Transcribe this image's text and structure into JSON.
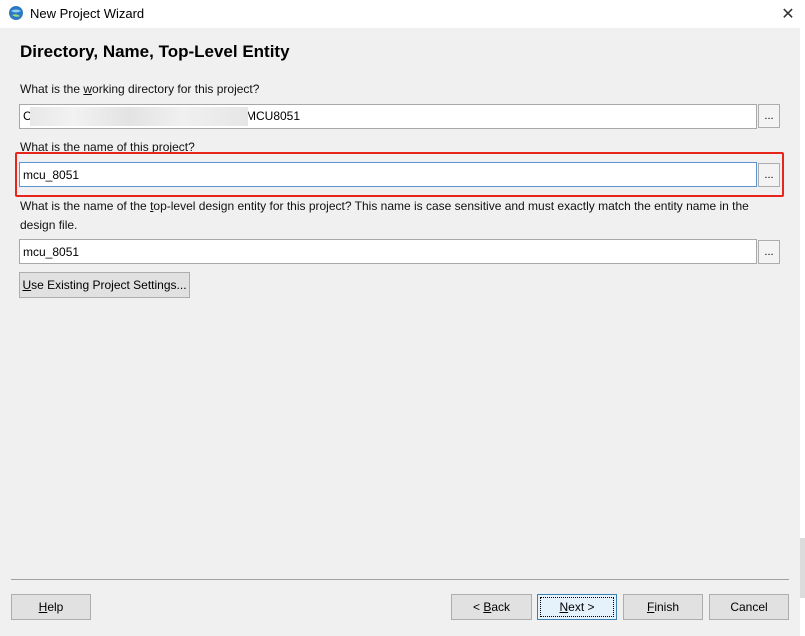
{
  "window": {
    "title": "New Project Wizard",
    "close_glyph": "✕",
    "icon": "app-globe-icon"
  },
  "page": {
    "title": "Directory, Name, Top-Level Entity"
  },
  "working_directory": {
    "label_prefix": "What is the ",
    "label_underlined": "w",
    "label_suffix": "orking directory for this project?",
    "value_start": "C",
    "value_end": "MCU8051",
    "browse_label": "..."
  },
  "project_name": {
    "label": "What is the name of this project?",
    "value": "mcu_8051",
    "browse_label": "..."
  },
  "top_level_entity": {
    "label_prefix": "What is the name of the ",
    "label_underlined": "t",
    "label_suffix": "op-level design entity for this project? This name is case sensitive and must exactly match the entity name in the design file.",
    "value": "mcu_8051",
    "browse_label": "..."
  },
  "use_existing_button": {
    "underlined": "U",
    "rest": "se Existing Project Settings..."
  },
  "footer": {
    "help": {
      "underlined": "H",
      "rest": "elp"
    },
    "back": {
      "prefix": "< ",
      "underlined": "B",
      "rest": "ack"
    },
    "next": {
      "underlined": "N",
      "rest": "ext >"
    },
    "finish": {
      "underlined": "F",
      "rest": "inish"
    },
    "cancel": {
      "label": "Cancel"
    }
  },
  "colors": {
    "highlight_box": "#e8251d",
    "focus_border": "#5d93d2",
    "dialog_background": "#f0f0f0"
  }
}
